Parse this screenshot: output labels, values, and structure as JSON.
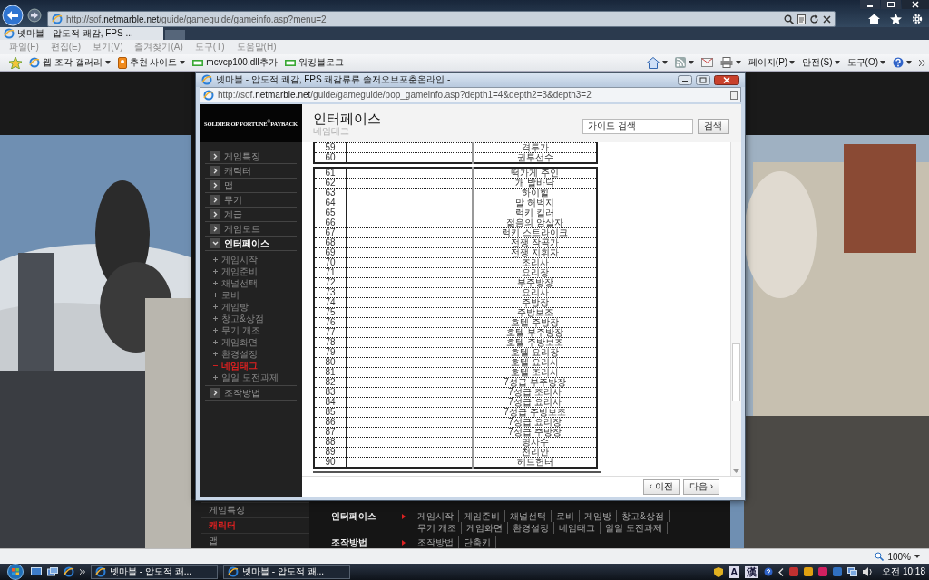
{
  "browser": {
    "address": "http://sof.**netmarble.net**/guide/gameguide/gameinfo.asp?menu=2",
    "tab": {
      "title": "넷마블 - 압도적 쾌감, FPS ..."
    },
    "menu": [
      "파일(F)",
      "편집(E)",
      "보기(V)",
      "즐겨찾기(A)",
      "도구(T)",
      "도움말(H)"
    ],
    "favorites": [
      {
        "label": "웹 조각 갤러리",
        "kind": "gallery"
      },
      {
        "label": "추천 사이트",
        "kind": "sites"
      },
      {
        "label": "mcvcp100.dll추가",
        "kind": "link"
      },
      {
        "label": "워킹블로그",
        "kind": "link"
      }
    ],
    "commands": [
      "페이지(P)",
      "안전(S)",
      "도구(O)"
    ],
    "zoom": "100%"
  },
  "page": {
    "sidebar": [
      {
        "label": "게임특징",
        "selected": false
      },
      {
        "label": "캐릭터",
        "selected": true
      },
      {
        "label": "맵",
        "selected": false
      }
    ],
    "footer": [
      {
        "title": "인터페이스",
        "links": [
          "게임시작",
          "게임준비",
          "채널선택",
          "로비",
          "게임방",
          "창고&상점",
          "무기 개조",
          "게임화면",
          "환경설정",
          "네임태그",
          "일일 도전과제"
        ]
      },
      {
        "title": "조작방법",
        "links": [
          "조작방법",
          "단축키"
        ]
      }
    ]
  },
  "popup": {
    "title": "넷마블 - 압도적 쾌감, FPS 쾌감류류 솔저오브포춘온라인 -",
    "address": "http://sof.**netmarble.net**/guide/gameguide/pop_gameinfo.asp?depth1=4&depth2=3&depth3=2",
    "logo": "SOLDIER OF FORTUNE$^{®}$PAYBACK",
    "nav": [
      {
        "label": "게임특징",
        "expanded": false
      },
      {
        "label": "캐릭터",
        "expanded": false
      },
      {
        "label": "맵",
        "expanded": false
      },
      {
        "label": "무기",
        "expanded": false
      },
      {
        "label": "계급",
        "expanded": false
      },
      {
        "label": "게임모드",
        "expanded": false
      },
      {
        "label": "인터페이스",
        "expanded": true,
        "children": [
          {
            "label": "게임시작",
            "selected": false
          },
          {
            "label": "게임준비",
            "selected": false
          },
          {
            "label": "채널선택",
            "selected": false
          },
          {
            "label": "로비",
            "selected": false
          },
          {
            "label": "게임방",
            "selected": false
          },
          {
            "label": "창고&상점",
            "selected": false
          },
          {
            "label": "무기 개조",
            "selected": false
          },
          {
            "label": "게임화면",
            "selected": false
          },
          {
            "label": "환경설정",
            "selected": false
          },
          {
            "label": "네임태그",
            "selected": true
          },
          {
            "label": "일일 도전과제",
            "selected": false
          }
        ]
      },
      {
        "label": "조작방법",
        "expanded": false
      }
    ],
    "heading": "인터페이스",
    "subheading": "네임태그",
    "search": {
      "value": "가이드 검색",
      "button": "검색"
    },
    "tables": [
      {
        "rows": [
          {
            "no": "59",
            "name": "격투가"
          },
          {
            "no": "60",
            "name": "권투선수"
          }
        ]
      },
      {
        "rows": [
          {
            "no": "61",
            "name": "떡가게 주인"
          },
          {
            "no": "62",
            "name": "개 발바닥"
          },
          {
            "no": "63",
            "name": "하이힐"
          },
          {
            "no": "64",
            "name": "말 허벅지"
          },
          {
            "no": "65",
            "name": "럭키 킬러"
          },
          {
            "no": "66",
            "name": "젊음의 암살자"
          },
          {
            "no": "67",
            "name": "럭키 스트라이크"
          },
          {
            "no": "68",
            "name": "전쟁 작곡가"
          },
          {
            "no": "69",
            "name": "전쟁 지휘자"
          },
          {
            "no": "70",
            "name": "조리사"
          },
          {
            "no": "71",
            "name": "요리장"
          },
          {
            "no": "72",
            "name": "부주방장"
          },
          {
            "no": "73",
            "name": "요리사"
          },
          {
            "no": "74",
            "name": "주방장"
          },
          {
            "no": "75",
            "name": "주방보조"
          },
          {
            "no": "76",
            "name": "호텔 주방장"
          },
          {
            "no": "77",
            "name": "호텔 부주방장"
          },
          {
            "no": "78",
            "name": "호텔 주방보조"
          },
          {
            "no": "79",
            "name": "호텔 요리장"
          },
          {
            "no": "80",
            "name": "호텔 요리사"
          },
          {
            "no": "81",
            "name": "호텔 조리사"
          },
          {
            "no": "82",
            "name": "7성급 부주방장"
          },
          {
            "no": "83",
            "name": "7성급 조리사"
          },
          {
            "no": "84",
            "name": "7성급 요리사"
          },
          {
            "no": "85",
            "name": "7성급 주방보조"
          },
          {
            "no": "86",
            "name": "7성급 요리장"
          },
          {
            "no": "87",
            "name": "7성급 주방장"
          },
          {
            "no": "88",
            "name": "명사수"
          },
          {
            "no": "89",
            "name": "천리안"
          },
          {
            "no": "90",
            "name": "헤드헌터"
          }
        ]
      }
    ],
    "buttons": [
      "‹ 이전",
      "다음 ›"
    ]
  },
  "taskbar": {
    "tasks": [
      "넷마블 - 압도적 쾌...",
      "넷마블 - 압도적 쾌..."
    ],
    "ime": [
      "A",
      "漢"
    ],
    "clock": "오전 10:18"
  }
}
